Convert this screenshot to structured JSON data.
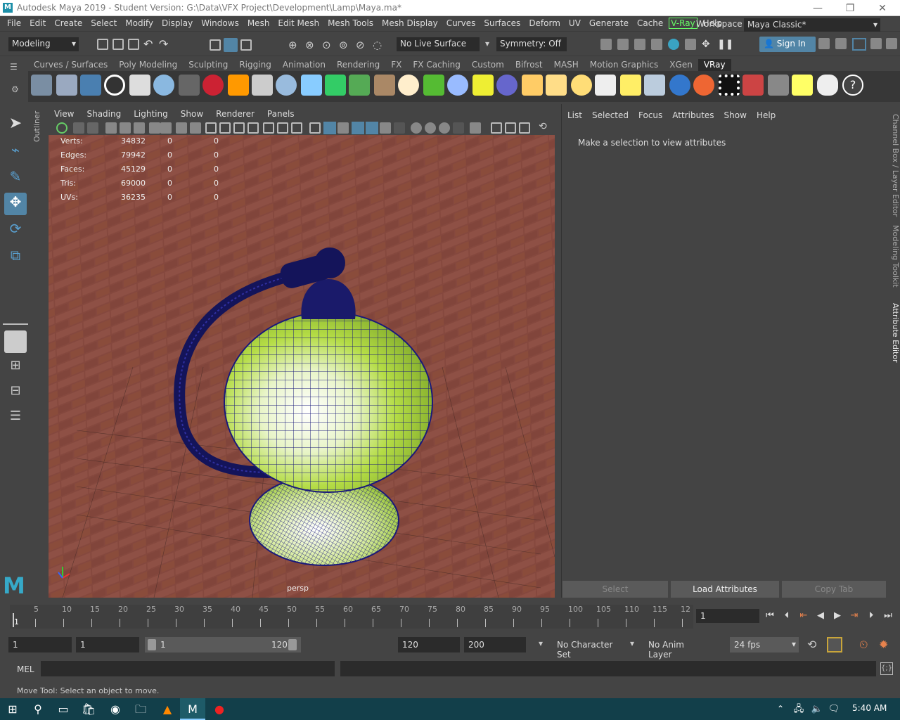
{
  "window": {
    "title": "Autodesk Maya 2019 - Student Version: G:\\Data\\VFX Project\\Development\\Lamp\\Maya.ma*",
    "minimize": "—",
    "restore": "❐",
    "close": "✕"
  },
  "menubar": {
    "items": [
      "File",
      "Edit",
      "Create",
      "Select",
      "Modify",
      "Display",
      "Windows",
      "Mesh",
      "Edit Mesh",
      "Mesh Tools",
      "Mesh Display",
      "Curves",
      "Surfaces",
      "Deform",
      "UV",
      "Generate",
      "Cache"
    ],
    "vray": "V-Ray",
    "help": "Help",
    "workspace_label": "Workspace :",
    "workspace_value": "Maya Classic*"
  },
  "statusline": {
    "mode": "Modeling",
    "live_surface": "No Live Surface",
    "symmetry": "Symmetry: Off",
    "sign_in": "Sign In"
  },
  "shelf": {
    "tabs": [
      "Curves / Surfaces",
      "Poly Modeling",
      "Sculpting",
      "Rigging",
      "Animation",
      "Rendering",
      "FX",
      "FX Caching",
      "Custom",
      "Bifrost",
      "MASH",
      "Motion Graphics",
      "XGen",
      "VRay"
    ],
    "active_tab": "VRay"
  },
  "outliner_tab": "Outliner",
  "viewport": {
    "menus": [
      "View",
      "Shading",
      "Lighting",
      "Show",
      "Renderer",
      "Panels"
    ],
    "camera": "persp",
    "hud": [
      {
        "label": "Verts:",
        "value": "34832",
        "a": "0",
        "b": "0"
      },
      {
        "label": "Edges:",
        "value": "79942",
        "a": "0",
        "b": "0"
      },
      {
        "label": "Faces:",
        "value": "45129",
        "a": "0",
        "b": "0"
      },
      {
        "label": "Tris:",
        "value": "69000",
        "a": "0",
        "b": "0"
      },
      {
        "label": "UVs:",
        "value": "36235",
        "a": "0",
        "b": "0"
      }
    ]
  },
  "attribute_editor": {
    "menus": [
      "List",
      "Selected",
      "Focus",
      "Attributes",
      "Show",
      "Help"
    ],
    "message": "Make a selection to view attributes",
    "buttons": {
      "select": "Select",
      "load": "Load Attributes",
      "copy": "Copy Tab"
    }
  },
  "side_tabs": [
    "Channel Box / Layer Editor",
    "Modeling Toolkit",
    "Attribute Editor"
  ],
  "timeline": {
    "ticks": [
      "5",
      "10",
      "15",
      "20",
      "25",
      "30",
      "35",
      "40",
      "45",
      "50",
      "55",
      "60",
      "65",
      "70",
      "75",
      "80",
      "85",
      "90",
      "95",
      "100",
      "105",
      "110",
      "115",
      "12"
    ],
    "current_marker": "1",
    "current_frame": "1"
  },
  "range": {
    "start": "1",
    "anim_start": "1",
    "slider_start": "1",
    "slider_end": "120",
    "end": "120",
    "anim_end": "200",
    "character_set": "No Character Set",
    "anim_layer": "No Anim Layer",
    "fps": "24 fps"
  },
  "command_line": {
    "label": "MEL"
  },
  "help_line": "Move Tool: Select an object to move.",
  "taskbar": {
    "clock": "5:40 AM"
  },
  "colors": {
    "accent_blue": "#5285a6",
    "vray_green": "#66ff66",
    "maya_teal": "#1d8fa8",
    "taskbar": "#123f4a",
    "lamp_green": "#a8d43a",
    "wire": "#1a1a7a"
  }
}
